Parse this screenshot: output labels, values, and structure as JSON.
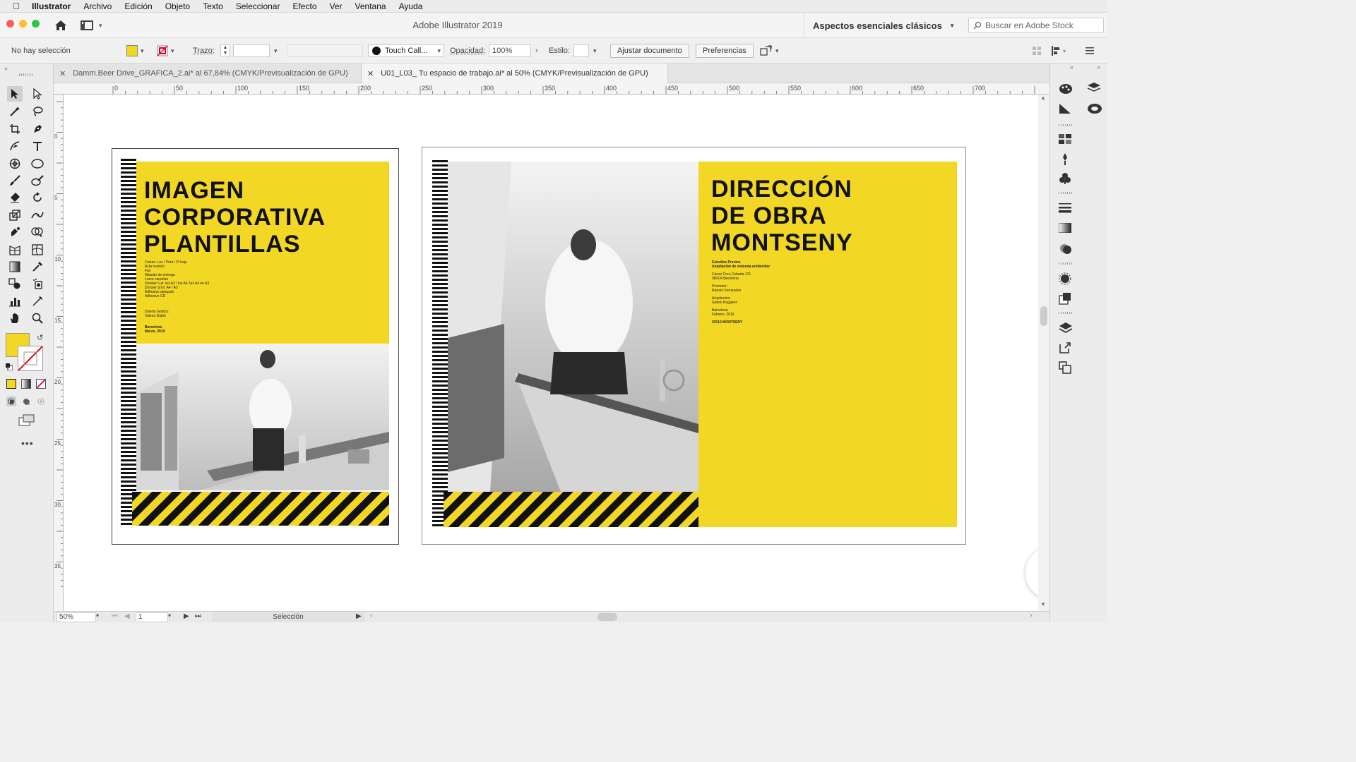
{
  "menubar": {
    "app_name": "Illustrator",
    "items": [
      "Archivo",
      "Edición",
      "Objeto",
      "Texto",
      "Seleccionar",
      "Efecto",
      "Ver",
      "Ventana",
      "Ayuda"
    ]
  },
  "titlebar": {
    "title": "Adobe Illustrator 2019",
    "workspace": "Aspectos esenciales clásicos",
    "stock_search_placeholder": "Buscar en Adobe Stock"
  },
  "control": {
    "selection_status": "No hay selección",
    "stroke_label": "Trazo:",
    "brush_label": "Touch Call...",
    "opacity_label": "Opacidad:",
    "opacity_value": "100%",
    "style_label": "Estilo:",
    "adjust_button": "Ajustar documento",
    "prefs_button": "Preferencias"
  },
  "tabs": [
    {
      "label": "Damm.Beer Drive_GRAFICA_2.ai* al 67,84% (CMYK/Previsualización de GPU)",
      "active": false
    },
    {
      "label": "U01_L03_ Tu espacio de trabajo.ai* al 50% (CMYK/Previsualización de GPU)",
      "active": true
    }
  ],
  "ruler": {
    "h_ticks": [
      "0",
      "50",
      "100",
      "150",
      "200",
      "250",
      "300",
      "350",
      "400",
      "450",
      "500",
      "550",
      "600",
      "650",
      "700"
    ],
    "v_ticks": [
      "0",
      "5",
      "1\n0",
      "1\n5",
      "2\n0",
      "2\n5",
      "3\n0",
      "3\n5"
    ]
  },
  "artboard1": {
    "title": "IMAGEN\nCORPORATIVA\nPLANTILLAS",
    "list": "Cartas: Lux / Print / 2ª hoja\nActa reunión\nFax\nAlbarán de entrega\nLomo carpetas\nDossier Lux: lux A3 / lux A4 /lux A4 en A3\nDossier print: A4 / A3\nAdhesivo alargado\nAdhesivo CD",
    "credits": "Diseño Gráfico:\nValeria Dubin",
    "footer": "Barcelona\nMarzo, 2019"
  },
  "artboard2": {
    "title": "DIRECCIÓN\nDE OBRA\nMONTSENY",
    "subtitle": "Estudios Previos\nAmpliación de vivienda unifamiliar",
    "address": "Carrer Creu Coberta 121\n08014 Barcelona",
    "promoter": "Promotor:\nRamón Fernandez",
    "architects": "Arquitectes:\nGianni Ruggiero",
    "date": "Barcelona\nFebrero, 2019",
    "code": "03110 MONTSENY"
  },
  "status": {
    "zoom": "50%",
    "artboard_num": "1",
    "tool_name": "Selección"
  },
  "colors": {
    "accent_yellow": "#f3d725",
    "brand_red": "#e0001a"
  }
}
